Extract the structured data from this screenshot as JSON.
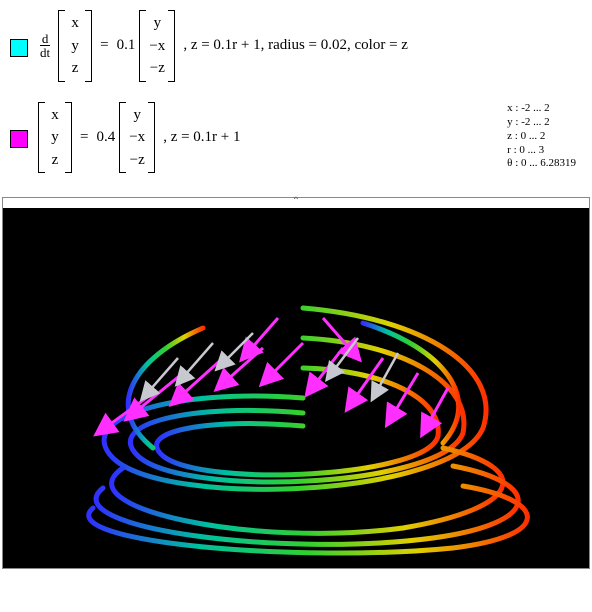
{
  "equations": [
    {
      "swatch_color": "cyan",
      "lhs_prefix": "d/dt",
      "vector_in": [
        "x",
        "y",
        "z"
      ],
      "equals": "=",
      "coef": "0.1",
      "vector_out": [
        "y",
        "−x",
        "−z"
      ],
      "tail": ", z = 0.1r + 1, radius = 0.02, color = z"
    },
    {
      "swatch_color": "magenta",
      "lhs_prefix": "",
      "vector_in": [
        "x",
        "y",
        "z"
      ],
      "equals": "=",
      "coef": "0.4",
      "vector_out": [
        "y",
        "−x",
        "−z"
      ],
      "tail": ", z = 0.1r + 1"
    }
  ],
  "ranges": [
    "x : -2 ... 2",
    "y : -2 ... 2",
    "z : 0  ... 2",
    "r : 0  ... 3",
    "θ : 0  ... 6.28319"
  ],
  "frac": {
    "num": "d",
    "den": "dt"
  }
}
